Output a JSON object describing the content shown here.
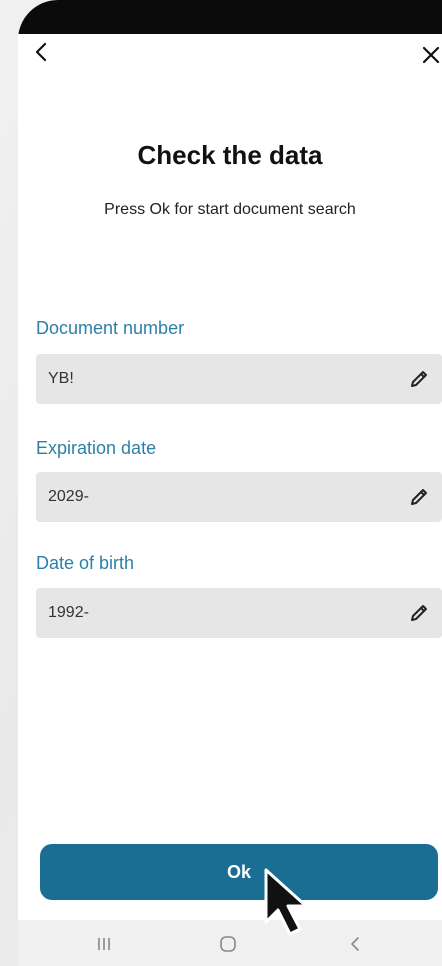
{
  "header": {
    "back_icon": "chevron-left-icon",
    "close_icon": "close-icon"
  },
  "title": "Check the data",
  "subtitle": "Press Ok for start document search",
  "fields": [
    {
      "label": "Document number",
      "value": "YB!"
    },
    {
      "label": "Expiration date",
      "value": "2029-"
    },
    {
      "label": "Date of birth",
      "value": "1992-"
    }
  ],
  "ok_button": {
    "label": "Ok"
  },
  "nav": {
    "recent_icon": "recent-apps-icon",
    "home_icon": "home-icon",
    "back_icon": "nav-back-icon"
  },
  "colors": {
    "accent": "#2c80a8",
    "button": "#1a6e93",
    "field_bg": "#e6e6e6"
  }
}
